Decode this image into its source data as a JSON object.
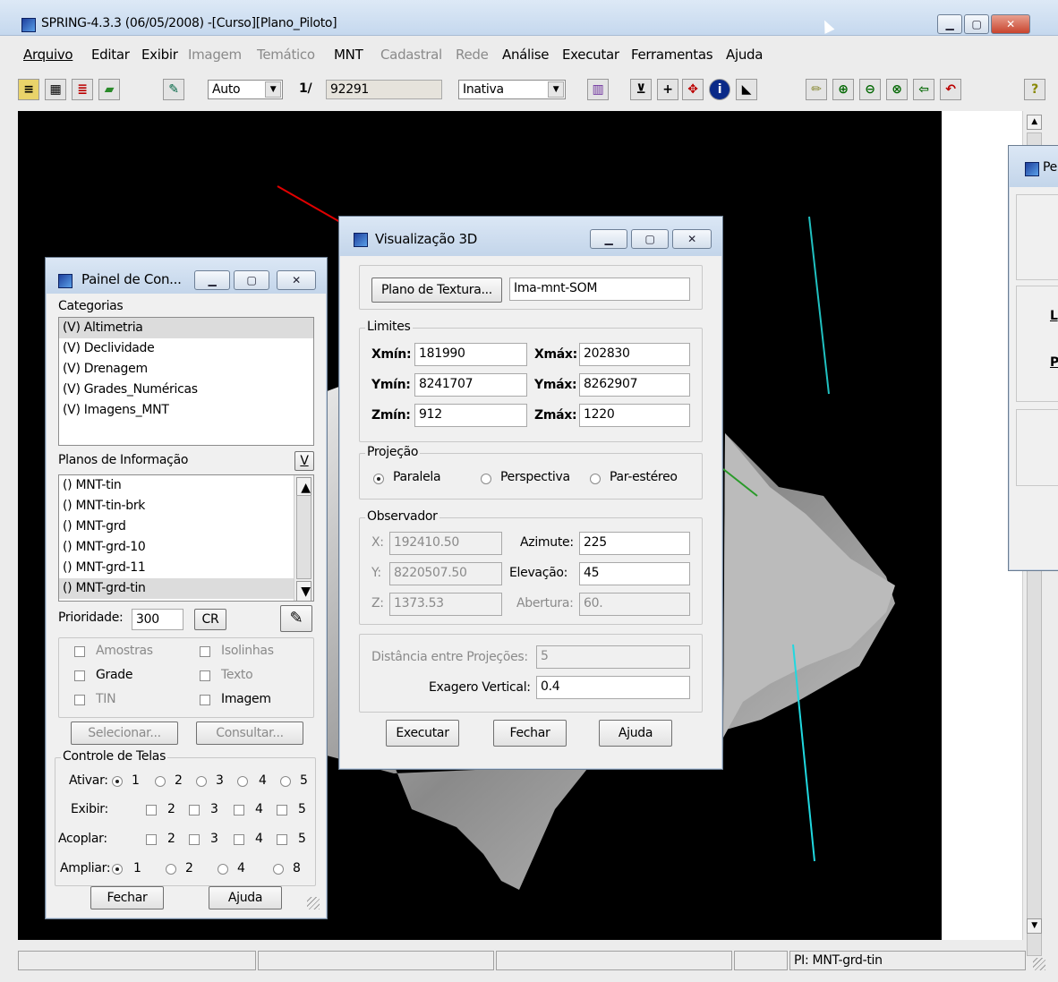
{
  "app": {
    "title": "SPRING-4.3.3 (06/05/2008) -[Curso][Plano_Piloto]"
  },
  "menu": [
    "Arquivo",
    "Editar",
    "Exibir",
    "Imagem",
    "Temático",
    "MNT",
    "Cadastral",
    "Rede",
    "Análise",
    "Executar",
    "Ferramentas",
    "Ajuda"
  ],
  "toolbar": {
    "zoom_mode": "Auto",
    "scale_prefix": "1/",
    "scale_value": "92291",
    "state": "Inativa",
    "help_glyph": "?"
  },
  "side_window": {
    "title_fragment": "Pe",
    "label_1": "L",
    "label_2": "P"
  },
  "painel": {
    "title": "Painel de Con...",
    "categorias_label": "Categorias",
    "categorias": [
      "(V) Altimetria",
      "(V) Declividade",
      "(V) Drenagem",
      "(V) Grades_Numéricas",
      "(V) Imagens_MNT"
    ],
    "planos_label": "Planos de Informação",
    "v_button": "V",
    "planos": [
      "() MNT-tin",
      "() MNT-tin-brk",
      "() MNT-grd",
      "() MNT-grd-10",
      "() MNT-grd-11",
      "() MNT-grd-tin"
    ],
    "prioridade_label": "Prioridade:",
    "prioridade_value": "300",
    "cr_button": "CR",
    "chk": {
      "amostras": "Amostras",
      "isolinhas": "Isolinhas",
      "grade": "Grade",
      "texto": "Texto",
      "tin": "TIN",
      "imagem": "Imagem"
    },
    "selecionar": "Selecionar...",
    "consultar": "Consultar...",
    "controle_title": "Controle de Telas",
    "ativar_label": "Ativar:",
    "exibir_label": "Exibir:",
    "acoplar_label": "Acoplar:",
    "ampliar_label": "Ampliar:",
    "n": [
      "1",
      "2",
      "3",
      "4",
      "5",
      "8"
    ],
    "fechar": "Fechar",
    "ajuda": "Ajuda"
  },
  "vis3d": {
    "title": "Visualização 3D",
    "plano_textura_btn": "Plano de Textura...",
    "plano_textura_value": "Ima-mnt-SOM",
    "limites_title": "Limites",
    "xmin_label": "Xmín:",
    "xmin": "181990",
    "xmax_label": "Xmáx:",
    "xmax": "202830",
    "ymin_label": "Ymín:",
    "ymin": "8241707",
    "ymax_label": "Ymáx:",
    "ymax": "8262907",
    "zmin_label": "Zmín:",
    "zmin": "912",
    "zmax_label": "Zmáx:",
    "zmax": "1220",
    "projecao_title": "Projeção",
    "paralela": "Paralela",
    "perspectiva": "Perspectiva",
    "parestereo": "Par-estéreo",
    "observador_title": "Observador",
    "x_label": "X:",
    "x_value": "192410.50",
    "y_label": "Y:",
    "y_value": "8220507.50",
    "z_label": "Z:",
    "z_value": "1373.53",
    "azimute_label": "Azimute:",
    "azimute": "225",
    "elevacao_label": "Elevação:",
    "elevacao": "45",
    "abertura_label": "Abertura:",
    "abertura": "60.",
    "distancia_label": "Distância entre Projeções:",
    "distancia": "5",
    "exagero_label": "Exagero Vertical:",
    "exagero": "0.4",
    "executar": "Executar",
    "fechar": "Fechar",
    "ajuda": "Ajuda"
  },
  "status": {
    "pi": "PI: MNT-grd-tin"
  }
}
